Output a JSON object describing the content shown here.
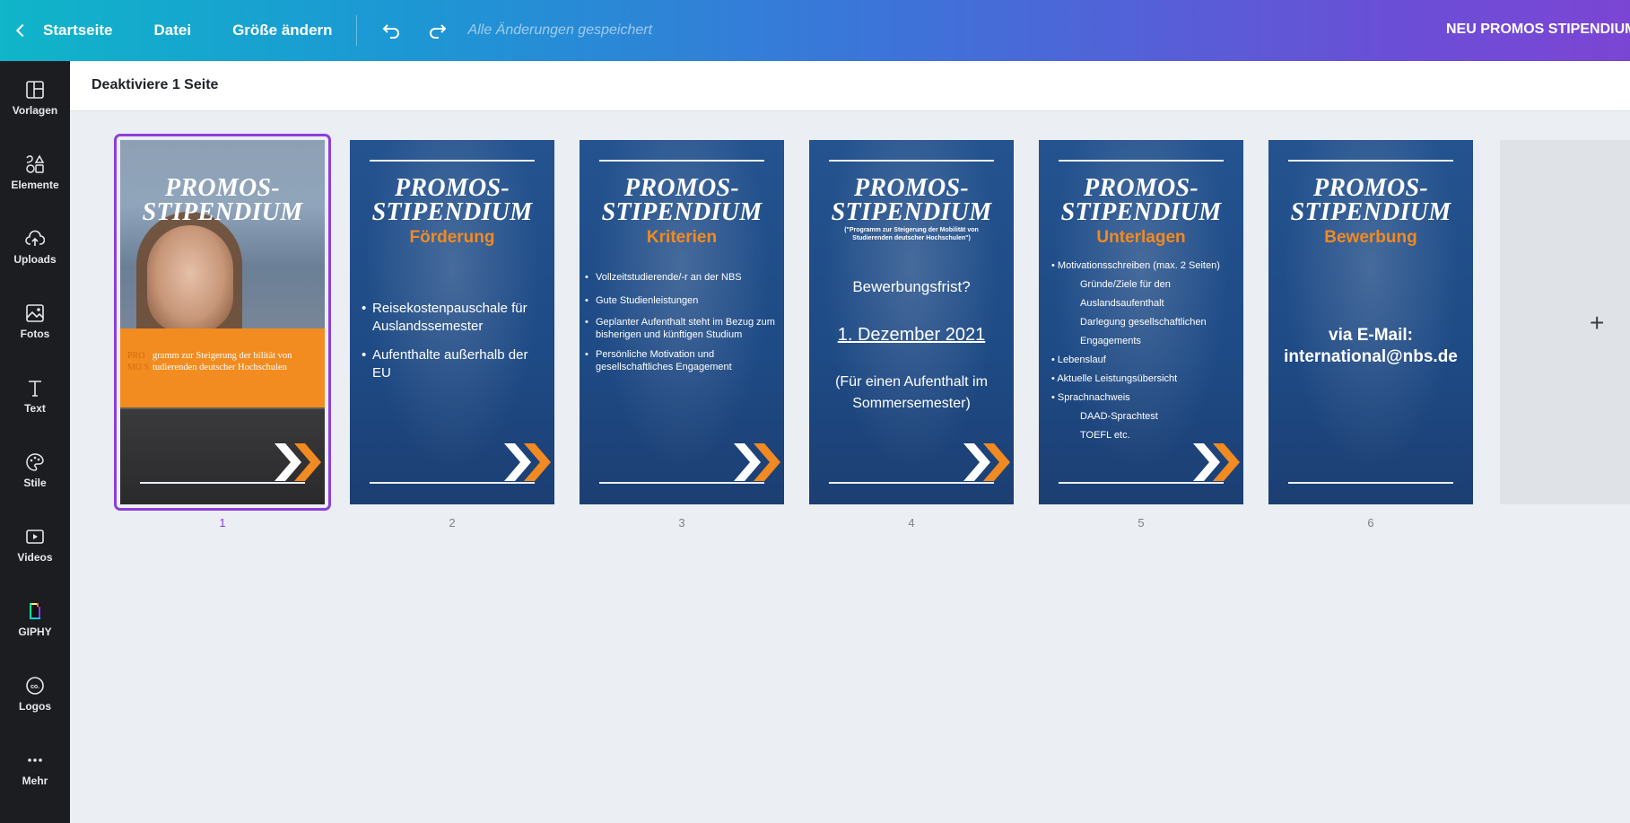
{
  "topbar": {
    "back_label": "Startseite",
    "file_label": "Datei",
    "resize_label": "Größe ändern",
    "status": "Alle Änderungen gespeichert",
    "design_title": "NEU PROMOS STIPENDIUM"
  },
  "sidebar": {
    "items": [
      {
        "label": "Vorlagen",
        "icon": "layout-icon"
      },
      {
        "label": "Elemente",
        "icon": "shapes-icon"
      },
      {
        "label": "Uploads",
        "icon": "cloud-upload-icon"
      },
      {
        "label": "Fotos",
        "icon": "image-icon"
      },
      {
        "label": "Text",
        "icon": "text-icon"
      },
      {
        "label": "Stile",
        "icon": "palette-icon"
      },
      {
        "label": "Videos",
        "icon": "video-icon"
      },
      {
        "label": "GIPHY",
        "icon": "giphy-icon"
      },
      {
        "label": "Logos",
        "icon": "logo-icon"
      },
      {
        "label": "Mehr",
        "icon": "more-icon"
      }
    ]
  },
  "subbar": {
    "label": "Deaktiviere 1 Seite"
  },
  "pages": [
    {
      "number": "1",
      "title_line1": "PROMOS-",
      "title_line2": "STIPENDIUM",
      "band_small": "PRO MO S",
      "band_text": "gramm zur Steigerung der bilität von tudierenden deutscher Hochschulen"
    },
    {
      "number": "2",
      "title_line1": "PROMOS-",
      "title_line2": "STIPENDIUM",
      "subtitle": "Förderung",
      "bullets": [
        "Reisekostenpauschale für Auslandssemester",
        "Aufenthalte außerhalb der EU"
      ]
    },
    {
      "number": "3",
      "title_line1": "PROMOS-",
      "title_line2": "STIPENDIUM",
      "subtitle": "Kriterien",
      "bullets": [
        "Vollzeitstudierende/-r an der NBS",
        "Gute Studienleistungen",
        "Geplanter Aufenthalt steht im Bezug zum bisherigen und künftigen Studium",
        "Persönliche Motivation und gesellschaftliches Engagement"
      ]
    },
    {
      "number": "4",
      "title_line1": "PROMOS-",
      "title_line2": "STIPENDIUM",
      "small_note": "(\"Programm zur Steigerung der Mobilität von Studierenden deutscher Hochschulen\")",
      "question": "Bewerbungsfrist?",
      "date": "1. Dezember 2021",
      "note": "(Für einen Aufenthalt im Sommersemester)"
    },
    {
      "number": "5",
      "title_line1": "PROMOS-",
      "title_line2": "STIPENDIUM",
      "subtitle": "Unterlagen",
      "b1": "Motivationsschreiben (max. 2 Seiten)",
      "b1a": "Gründe/Ziele für den Auslandsaufenthalt",
      "b1b": "Darlegung gesellschaftlichen Engagements",
      "b2": "Lebenslauf",
      "b3": "Aktuelle Leistungsübersicht",
      "b4": "Sprachnachweis",
      "b4a": "DAAD-Sprachtest",
      "b4b": "TOEFL etc."
    },
    {
      "number": "6",
      "title_line1": "PROMOS-",
      "title_line2": "STIPENDIUM",
      "subtitle": "Bewerbung",
      "line1": "via E-Mail:",
      "line2": "international@nbs.de"
    }
  ],
  "add_page": {
    "label": "+"
  },
  "colors": {
    "accent": "#8b3fd9",
    "orange": "#f18a21",
    "slide_blue": "#1f4f8a",
    "sidebar": "#1b1d21"
  }
}
